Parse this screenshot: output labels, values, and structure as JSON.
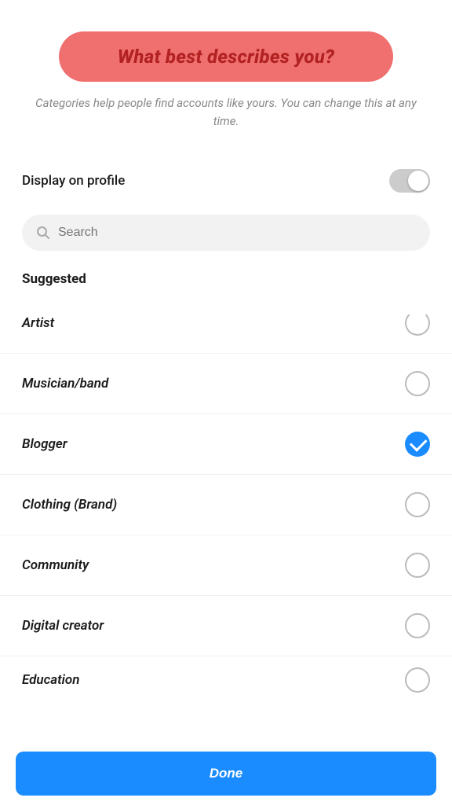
{
  "header": {
    "title": "What best describes you?",
    "subtitle": "Categories help people find accounts like yours. You can change this at any time."
  },
  "display_profile": {
    "label": "Display on profile",
    "toggle_on": false
  },
  "search": {
    "placeholder": "Search"
  },
  "suggested_label": "Suggested",
  "categories": [
    {
      "id": "artist",
      "label": "Artist",
      "selected": false,
      "partial": true
    },
    {
      "id": "musician-band",
      "label": "Musician/band",
      "selected": false,
      "partial": false
    },
    {
      "id": "blogger",
      "label": "Blogger",
      "selected": true,
      "partial": false
    },
    {
      "id": "clothing-brand",
      "label": "Clothing (Brand)",
      "selected": false,
      "partial": false
    },
    {
      "id": "community",
      "label": "Community",
      "selected": false,
      "partial": false
    },
    {
      "id": "digital-creator",
      "label": "Digital creator",
      "selected": false,
      "partial": false
    },
    {
      "id": "education",
      "label": "Education",
      "selected": false,
      "partial": false
    }
  ],
  "done_button": {
    "label": "Done"
  }
}
